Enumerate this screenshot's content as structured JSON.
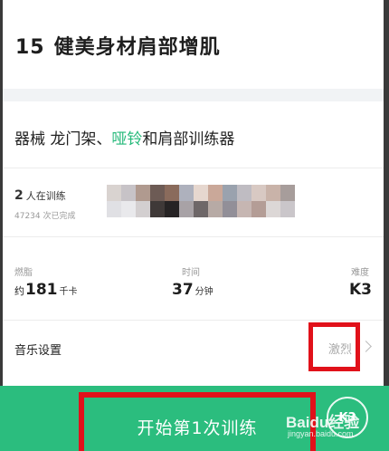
{
  "header": {
    "number": "15",
    "title": "健美身材肩部增肌"
  },
  "equipment": {
    "prefix": "器械 龙门架、",
    "link": "哑铃",
    "suffix": "和肩部训练器"
  },
  "stats": {
    "training_count": "2",
    "training_label": "人在训练",
    "completed_text": "47234 次已完成"
  },
  "metrics": {
    "calories": {
      "label": "燃脂",
      "prefix": "约",
      "value": "181",
      "unit": "千卡"
    },
    "duration": {
      "label": "时间",
      "value": "37",
      "unit": "分钟"
    },
    "difficulty": {
      "label": "难度",
      "value": "K3"
    }
  },
  "music": {
    "label": "音乐设置",
    "value": "激烈"
  },
  "footer": {
    "start_label": "开始第1次训练",
    "badge": "K3",
    "watermark": "Baidu经验",
    "watermark_url": "jingyan.baidu.com"
  },
  "colors": {
    "accent": "#2bbd7e",
    "link": "#25b97a",
    "highlight": "#e1111a"
  }
}
